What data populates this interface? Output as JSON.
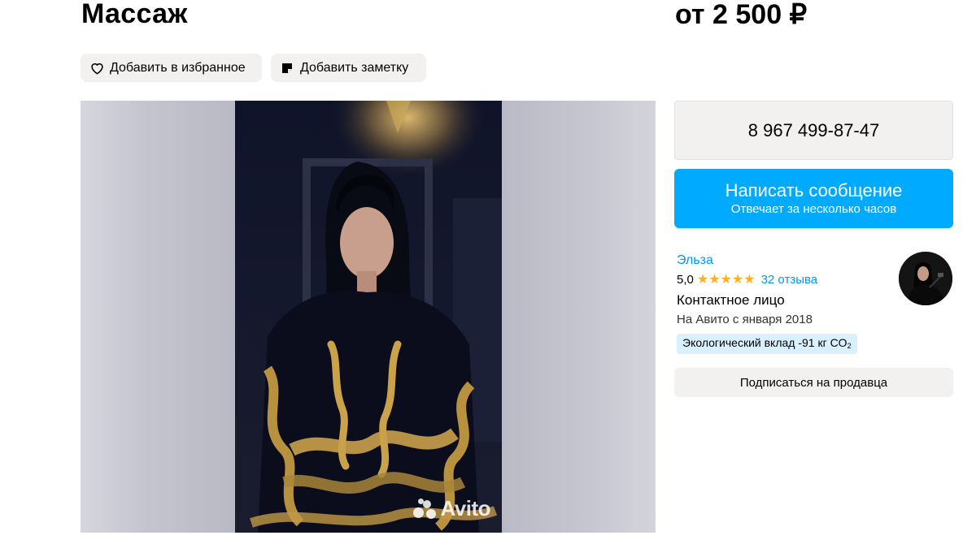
{
  "listing": {
    "title": "Массаж",
    "price": "от 2 500 ₽"
  },
  "actions": {
    "favorite_label": "Добавить в избранное",
    "note_label": "Добавить заметку"
  },
  "gallery": {
    "watermark": "Avito"
  },
  "contact": {
    "phone": "8 967 499-87-47",
    "message_label": "Написать сообщение",
    "message_sub": "Отвечает за несколько часов"
  },
  "seller": {
    "name": "Эльза",
    "rating": "5,0",
    "stars": 5,
    "reviews": "32 отзыва",
    "role": "Контактное лицо",
    "since": "На Авито с января 2018",
    "eco_badge": "Экологический вклад -91 кг CO",
    "eco_badge_sub": "2",
    "subscribe_label": "Подписаться на продавца"
  },
  "colors": {
    "accent": "#00aaff",
    "link": "#0099f7",
    "star": "#ffb021",
    "button_bg": "#f2f1f0",
    "eco_bg": "#d9f1ff"
  },
  "icons": {
    "favorite": "heart-icon",
    "note": "note-icon",
    "star": "star-icon"
  }
}
